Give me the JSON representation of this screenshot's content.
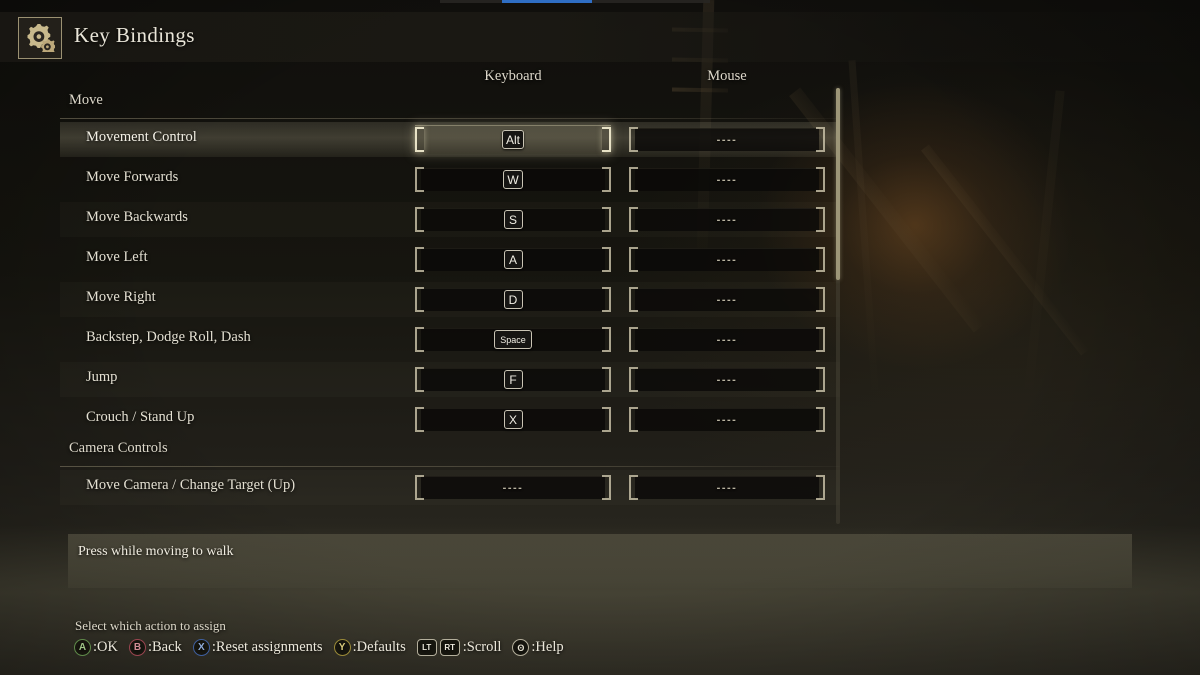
{
  "header": {
    "title": "Key Bindings",
    "icon": "gear-icon"
  },
  "columns": {
    "keyboard": "Keyboard",
    "mouse": "Mouse"
  },
  "sections": [
    {
      "name": "Move",
      "rows": [
        {
          "label": "Movement Control",
          "keyboard": "Alt",
          "keyboard_type": "key",
          "mouse": "----",
          "mouse_type": "empty",
          "selected": true
        },
        {
          "label": "Move Forwards",
          "keyboard": "W",
          "keyboard_type": "key",
          "mouse": "----",
          "mouse_type": "empty",
          "selected": false
        },
        {
          "label": "Move Backwards",
          "keyboard": "S",
          "keyboard_type": "key",
          "mouse": "----",
          "mouse_type": "empty",
          "selected": false
        },
        {
          "label": "Move Left",
          "keyboard": "A",
          "keyboard_type": "key",
          "mouse": "----",
          "mouse_type": "empty",
          "selected": false
        },
        {
          "label": "Move Right",
          "keyboard": "D",
          "keyboard_type": "key",
          "mouse": "----",
          "mouse_type": "empty",
          "selected": false
        },
        {
          "label": "Backstep, Dodge Roll, Dash",
          "keyboard": "Space",
          "keyboard_type": "key-wide",
          "mouse": "----",
          "mouse_type": "empty",
          "selected": false
        },
        {
          "label": "Jump",
          "keyboard": "F",
          "keyboard_type": "key",
          "mouse": "----",
          "mouse_type": "empty",
          "selected": false
        },
        {
          "label": "Crouch / Stand Up",
          "keyboard": "X",
          "keyboard_type": "key",
          "mouse": "----",
          "mouse_type": "empty",
          "selected": false
        }
      ]
    },
    {
      "name": "Camera Controls",
      "rows": [
        {
          "label": "Move Camera / Change Target (Up)",
          "keyboard": "----",
          "keyboard_type": "empty",
          "mouse": "----",
          "mouse_type": "empty",
          "selected": false
        }
      ]
    }
  ],
  "description": {
    "text": "Press while moving to walk"
  },
  "footer": {
    "hint": "Select which action to assign",
    "prompts": [
      {
        "button": "A",
        "kind": "pad",
        "color": "#5f8a4a",
        "label": ":OK"
      },
      {
        "button": "B",
        "kind": "pad",
        "color": "#9a4550",
        "label": ":Back"
      },
      {
        "button": "X",
        "kind": "pad",
        "color": "#3f5f9e",
        "label": ":Reset assignments"
      },
      {
        "button": "Y",
        "kind": "pad",
        "color": "#9a8a38",
        "label": ":Defaults"
      },
      {
        "button": "LT",
        "kind": "trigger",
        "color": "#b4af9c",
        "label": ""
      },
      {
        "button": "RT",
        "kind": "trigger",
        "color": "#b4af9c",
        "label": ":Scroll"
      },
      {
        "button": "ʘ",
        "kind": "pad-help",
        "color": "#b4af9c",
        "label": ":Help"
      }
    ]
  },
  "scrollbar": {
    "thumb_position_pct": 0,
    "thumb_size_pct": 44
  },
  "colors": {
    "highlight": "#d6ceaa",
    "text": "#e4e0d2",
    "panel": "#6c6854"
  }
}
